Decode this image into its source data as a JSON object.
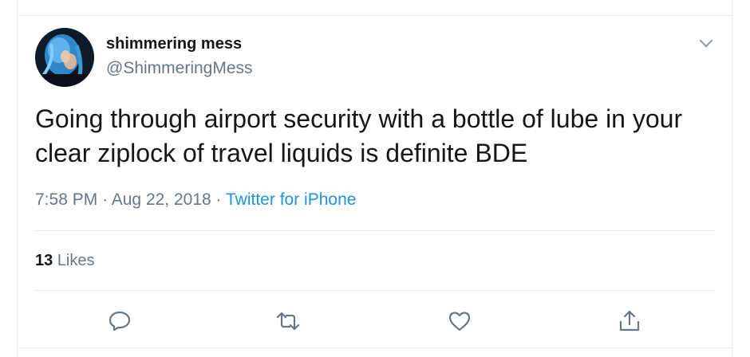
{
  "tweet": {
    "author": {
      "display_name": "shimmering mess",
      "handle": "@ShimmeringMess"
    },
    "text": "Going through airport security with a bottle of lube in your clear ziplock of travel liquids is definite BDE",
    "time": "7:58 PM",
    "date": "Aug 22, 2018",
    "separator": "·",
    "source": "Twitter for iPhone",
    "likes_count": "13",
    "likes_label": "Likes"
  },
  "icons": {
    "caret": "chevron-down-icon",
    "reply": "reply-icon",
    "retweet": "retweet-icon",
    "like": "heart-icon",
    "share": "share-icon"
  },
  "colors": {
    "text_primary": "#14171a",
    "text_secondary": "#657786",
    "link": "#1b95e0",
    "divider": "#e6ecf0"
  }
}
